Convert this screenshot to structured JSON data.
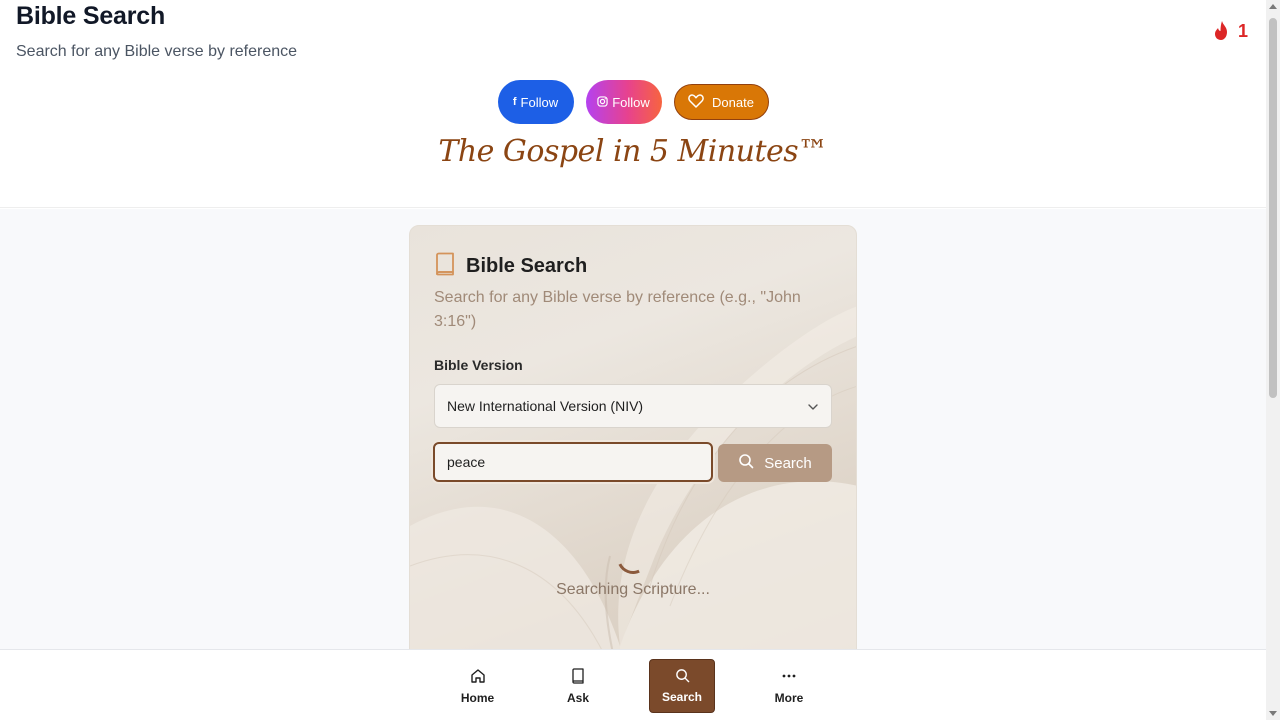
{
  "header": {
    "title": "Bible Search",
    "subtitle": "Search for any Bible verse by reference",
    "streak_count": "1",
    "streak_icon": "flame-icon"
  },
  "social": {
    "facebook_label": "Follow",
    "instagram_label": "Follow",
    "donate_label": "Donate"
  },
  "brand": {
    "text": "The Gospel in 5 Minutes™"
  },
  "card": {
    "title": "Bible Search",
    "description": "Search for any Bible verse by reference (e.g., \"John 3:16\")",
    "version_label": "Bible Version",
    "version_selected": "New International Version (NIV)",
    "search_value": "peace",
    "search_button_label": "Search",
    "loading_text": "Searching Scripture..."
  },
  "nav": {
    "items": [
      {
        "label": "Home",
        "icon": "home-icon"
      },
      {
        "label": "Ask",
        "icon": "book-icon"
      },
      {
        "label": "Search",
        "icon": "search-icon",
        "active": true
      },
      {
        "label": "More",
        "icon": "more-icon"
      }
    ]
  },
  "colors": {
    "accent_brown": "#7b4a2b",
    "facebook": "#1d5fe6",
    "donate": "#d97706",
    "streak": "#dc2626"
  }
}
